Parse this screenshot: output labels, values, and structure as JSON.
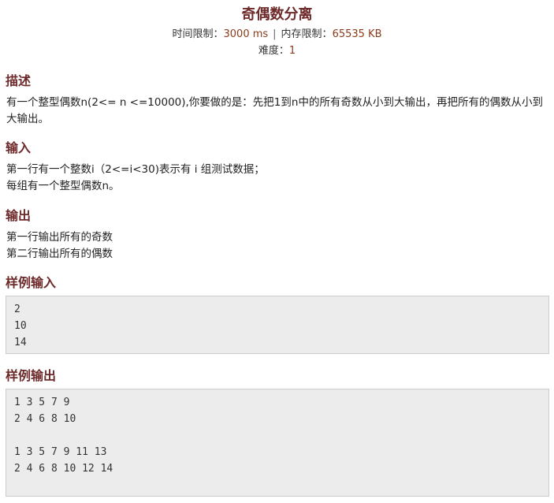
{
  "problem": {
    "title": "奇偶数分离",
    "time_limit_label": "时间限制：",
    "time_limit_value": "3000 ms",
    "separator": "|",
    "memory_limit_label": "内存限制：",
    "memory_limit_value": "65535 KB",
    "difficulty_label": "难度：",
    "difficulty_value": "1"
  },
  "description": {
    "heading": "描述",
    "text": "有一个整型偶数n(2<= n <=10000),你要做的是：先把1到n中的所有奇数从小到大输出，再把所有的偶数从小到大输出。"
  },
  "input": {
    "heading": "输入",
    "lines": [
      "第一行有一个整数i（2<=i<30)表示有 i 组测试数据；",
      "每组有一个整型偶数n。"
    ]
  },
  "output": {
    "heading": "输出",
    "lines": [
      "第一行输出所有的奇数",
      "第二行输出所有的偶数"
    ]
  },
  "sample_input": {
    "heading": "样例输入",
    "lines": [
      "2",
      "10",
      "14"
    ]
  },
  "sample_output": {
    "heading": "样例输出",
    "lines": [
      "1 3 5 7 9",
      "2 4 6 8 10",
      "",
      "1 3 5 7 9 11 13",
      "2 4 6 8 10 12 14"
    ]
  },
  "colors": {
    "heading": "#6e2a2a",
    "value": "#8a3b1b",
    "code_background": "#ececec"
  }
}
